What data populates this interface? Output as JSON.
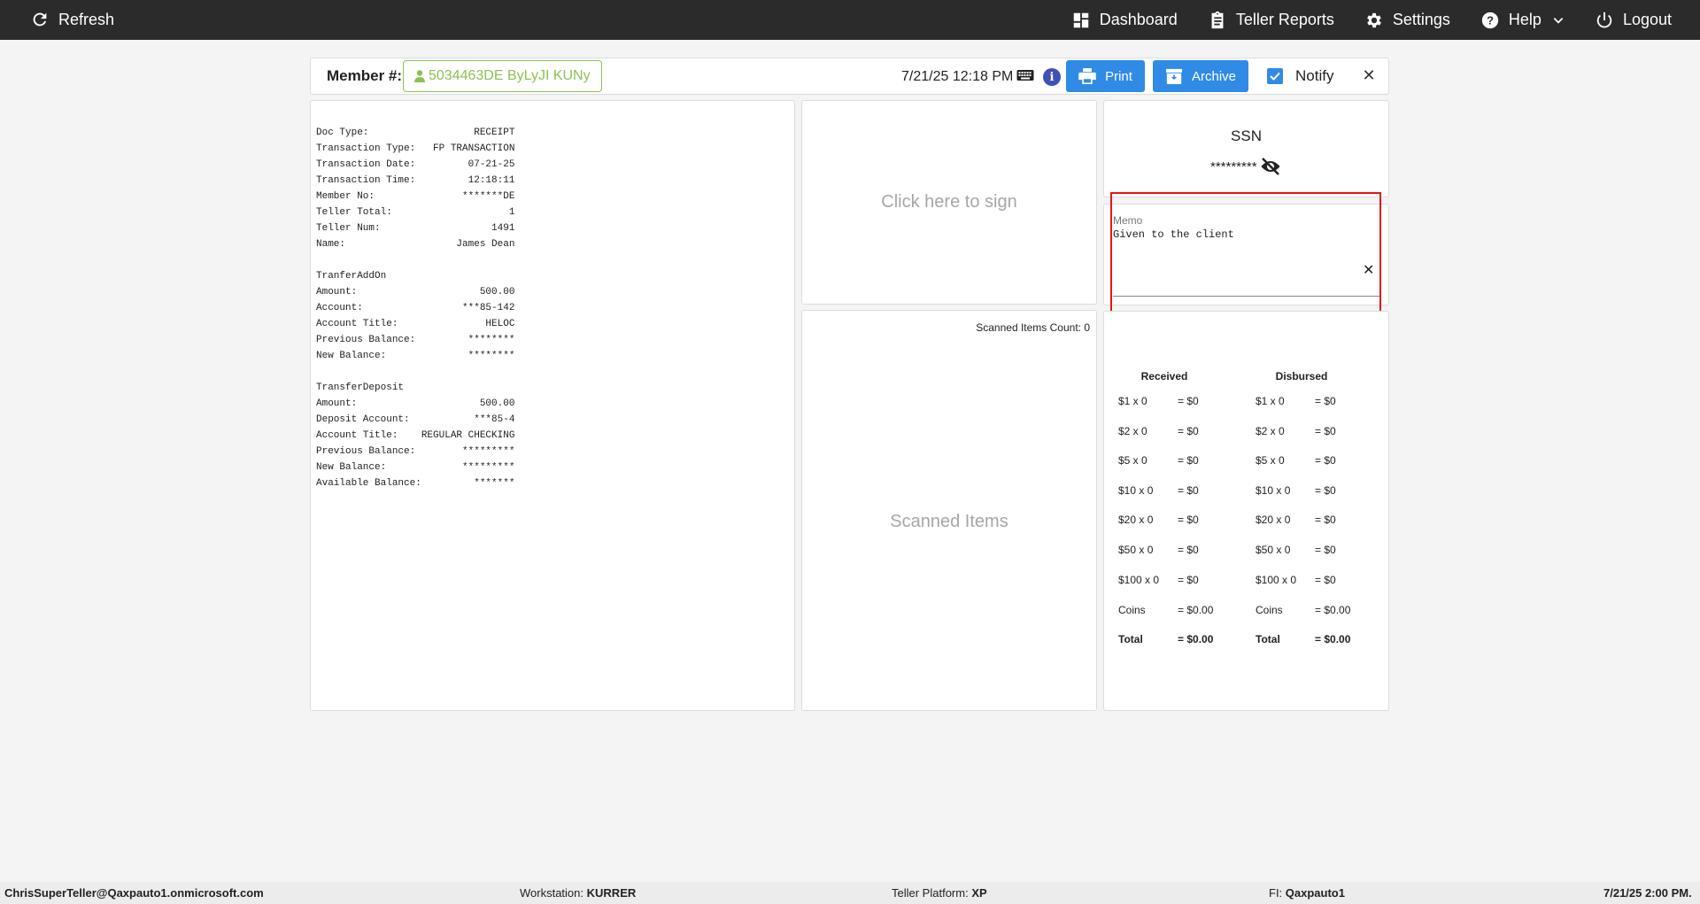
{
  "topbar": {
    "refresh_label": "Refresh",
    "dashboard_label": "Dashboard",
    "reports_label": "Teller Reports",
    "settings_label": "Settings",
    "help_label": "Help",
    "logout_label": "Logout"
  },
  "header": {
    "member_label": "Member #:",
    "member_value": "5034463DE ByLyJI KUNy",
    "datetime": "7/21/25 12:18 PM",
    "print_label": "Print",
    "archive_label": "Archive",
    "notify_label": "Notify",
    "notify_checked": true,
    "close_symbol": "✕"
  },
  "receipt": {
    "lines": [
      "Doc Type:                  RECEIPT",
      "Transaction Type:   FP TRANSACTION",
      "Transaction Date:         07-21-25",
      "Transaction Time:         12:18:11",
      "Member No:               *******DE",
      "Teller Total:                    1",
      "Teller Num:                   1491",
      "Name:                   James Dean",
      "",
      "TranferAddOn",
      "Amount:                     500.00",
      "Account:                 ***85-142",
      "Account Title:               HELOC",
      "Previous Balance:         ********",
      "New Balance:              ********",
      "",
      "TransferDeposit",
      "Amount:                     500.00",
      "Deposit Account:           ***85-4",
      "Account Title:    REGULAR CHECKING",
      "Previous Balance:        *********",
      "New Balance:             *********",
      "Available Balance:         *******"
    ]
  },
  "signature": {
    "prompt": "Click here to sign"
  },
  "scanned": {
    "count_label": "Scanned Items Count: 0",
    "placeholder": "Scanned Items"
  },
  "ssn": {
    "title": "SSN",
    "value": "*********"
  },
  "memo": {
    "label": "Memo",
    "value": "Given to the client",
    "clear_symbol": "✕"
  },
  "cash": {
    "received_header": "Received",
    "disbursed_header": "Disbursed",
    "received": [
      {
        "denom": "$1 x 0",
        "amount": "= $0"
      },
      {
        "denom": "$2 x 0",
        "amount": "= $0"
      },
      {
        "denom": "$5 x 0",
        "amount": "= $0"
      },
      {
        "denom": "$10 x 0",
        "amount": "= $0"
      },
      {
        "denom": "$20 x 0",
        "amount": "= $0"
      },
      {
        "denom": "$50 x 0",
        "amount": "= $0"
      },
      {
        "denom": "$100 x 0",
        "amount": "= $0"
      },
      {
        "denom": "Coins",
        "amount": "= $0.00"
      },
      {
        "denom": "Total",
        "amount": "= $0.00"
      }
    ],
    "disbursed": [
      {
        "denom": "$1 x 0",
        "amount": "= $0"
      },
      {
        "denom": "$2 x 0",
        "amount": "= $0"
      },
      {
        "denom": "$5 x 0",
        "amount": "= $0"
      },
      {
        "denom": "$10 x 0",
        "amount": "= $0"
      },
      {
        "denom": "$20 x 0",
        "amount": "= $0"
      },
      {
        "denom": "$50 x 0",
        "amount": "= $0"
      },
      {
        "denom": "$100 x 0",
        "amount": "= $0"
      },
      {
        "denom": "Coins",
        "amount": "= $0.00"
      },
      {
        "denom": "Total",
        "amount": "= $0.00"
      }
    ]
  },
  "footer": {
    "user": "ChrisSuperTeller@Qaxpauto1.onmicrosoft.com",
    "workstation_label": "Workstation:",
    "workstation_value": "KURRER",
    "platform_label": "Teller Platform:",
    "platform_value": "XP",
    "fi_label": "FI:",
    "fi_value": "Qaxpauto1",
    "datetime": "7/21/25 2:00 PM."
  },
  "colors": {
    "topbar_bg": "#2b2b2b",
    "accent_blue": "#2f8be6",
    "member_green": "#8cc152",
    "highlight_red": "#e81414"
  }
}
